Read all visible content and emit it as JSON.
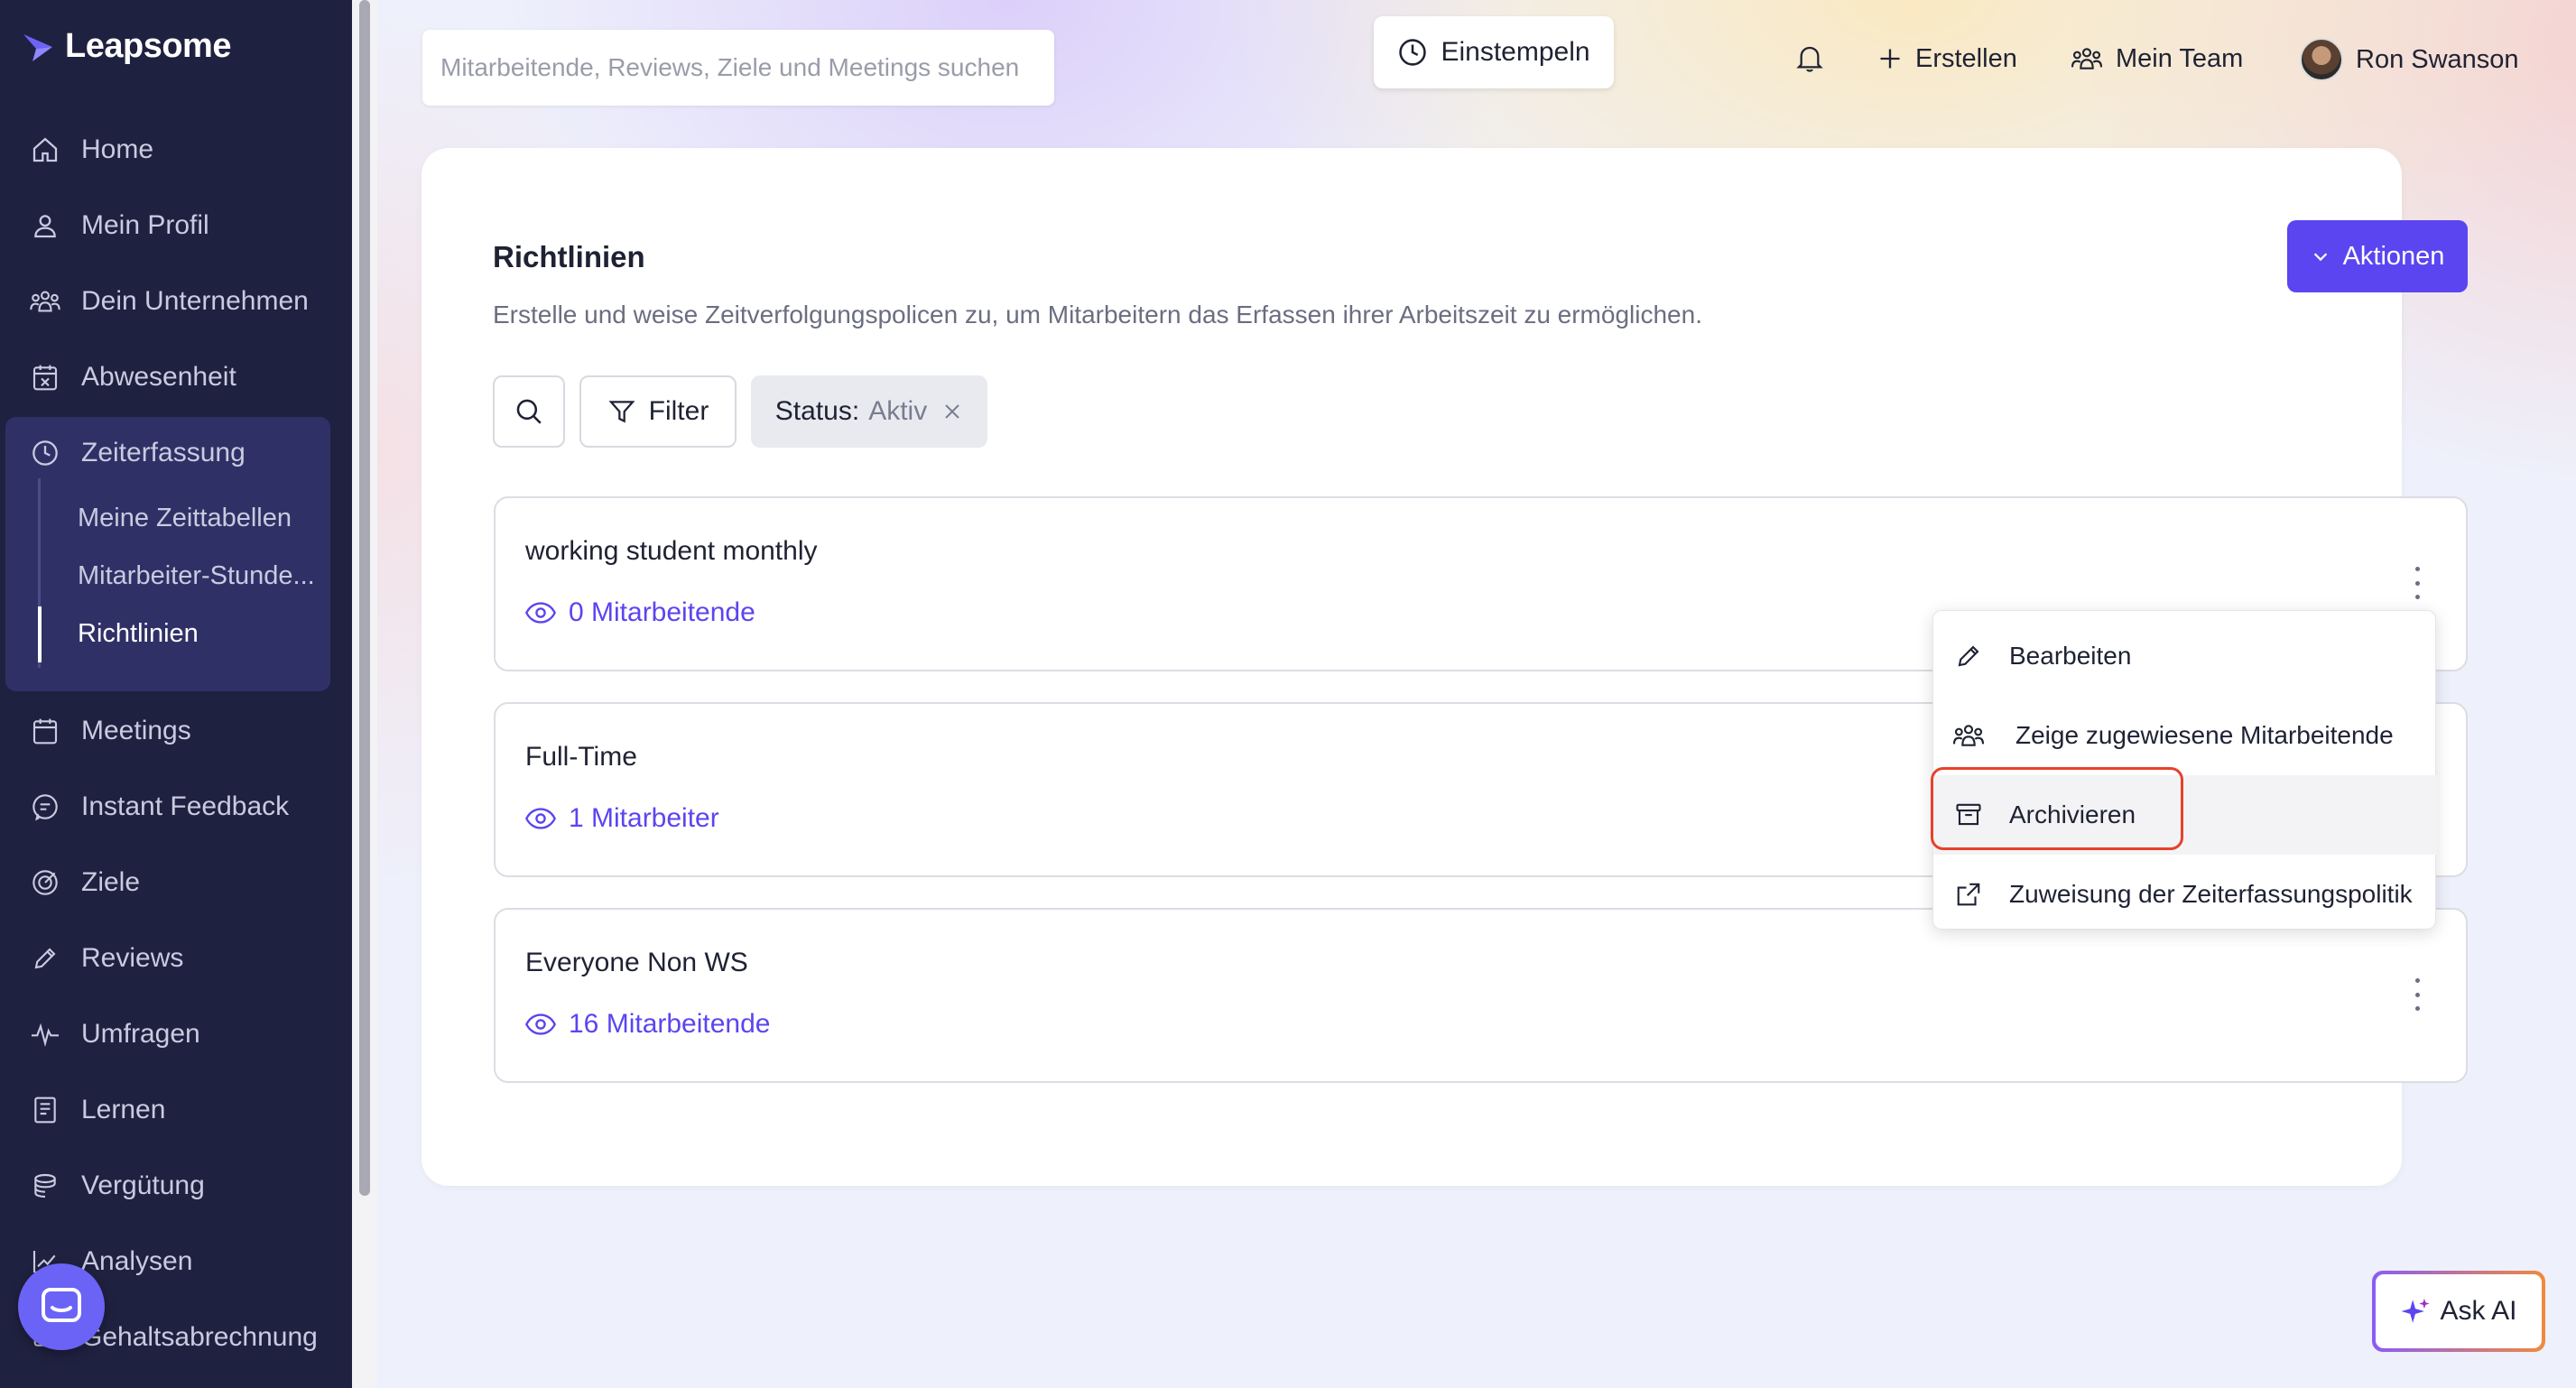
{
  "app": {
    "name": "Leapsome"
  },
  "sidebar": {
    "items": [
      {
        "label": "Home",
        "icon": "home-icon"
      },
      {
        "label": "Mein Profil",
        "icon": "user-icon"
      },
      {
        "label": "Dein Unternehmen",
        "icon": "users-icon"
      },
      {
        "label": "Abwesenheit",
        "icon": "calendar-x-icon"
      },
      {
        "label": "Zeiterfassung",
        "icon": "clock-icon"
      },
      {
        "label": "Meetings",
        "icon": "calendar-icon"
      },
      {
        "label": "Instant Feedback",
        "icon": "chat-icon"
      },
      {
        "label": "Ziele",
        "icon": "target-icon"
      },
      {
        "label": "Reviews",
        "icon": "pencil-icon"
      },
      {
        "label": "Umfragen",
        "icon": "pulse-icon"
      },
      {
        "label": "Lernen",
        "icon": "book-icon"
      },
      {
        "label": "Vergütung",
        "icon": "coins-icon"
      },
      {
        "label": "Analysen",
        "icon": "chart-icon"
      },
      {
        "label": "Gehaltsabrechnung",
        "icon": "payroll-icon"
      }
    ],
    "sub_items": [
      {
        "label": "Meine Zeittabellen"
      },
      {
        "label": "Mitarbeiter-Stunde..."
      },
      {
        "label": "Richtlinien"
      }
    ]
  },
  "topbar": {
    "search_placeholder": "Mitarbeitende, Reviews, Ziele und Meetings suchen",
    "clock_in": "Einstempeln",
    "create": "Erstellen",
    "my_team": "Mein Team",
    "user_name": "Ron Swanson"
  },
  "page": {
    "title": "Richtlinien",
    "description": "Erstelle und weise Zeitverfolgungspolicen zu, um Mitarbeitern das Erfassen ihrer Arbeitszeit zu ermöglichen.",
    "actions_button": "Aktionen",
    "filter_button": "Filter",
    "status_chip_key": "Status:",
    "status_chip_value": "Aktiv"
  },
  "policies": [
    {
      "name": "working student monthly",
      "members": "0 Mitarbeitende"
    },
    {
      "name": "Full-Time",
      "members": "1 Mitarbeiter"
    },
    {
      "name": "Everyone Non WS",
      "members": "16 Mitarbeitende"
    }
  ],
  "menu": {
    "items": [
      {
        "label": "Bearbeiten",
        "icon": "pencil-icon"
      },
      {
        "label": "Zeige zugewiesene Mitarbeitende",
        "icon": "users-icon"
      },
      {
        "label": "Archivieren",
        "icon": "archive-icon"
      },
      {
        "label": "Zuweisung der Zeiterfassungspolitik",
        "icon": "external-link-icon"
      }
    ]
  },
  "ask_ai": "Ask AI",
  "colors": {
    "accent": "#5b45f0",
    "sidebar": "#1f2140",
    "highlight": "#e8402a"
  }
}
